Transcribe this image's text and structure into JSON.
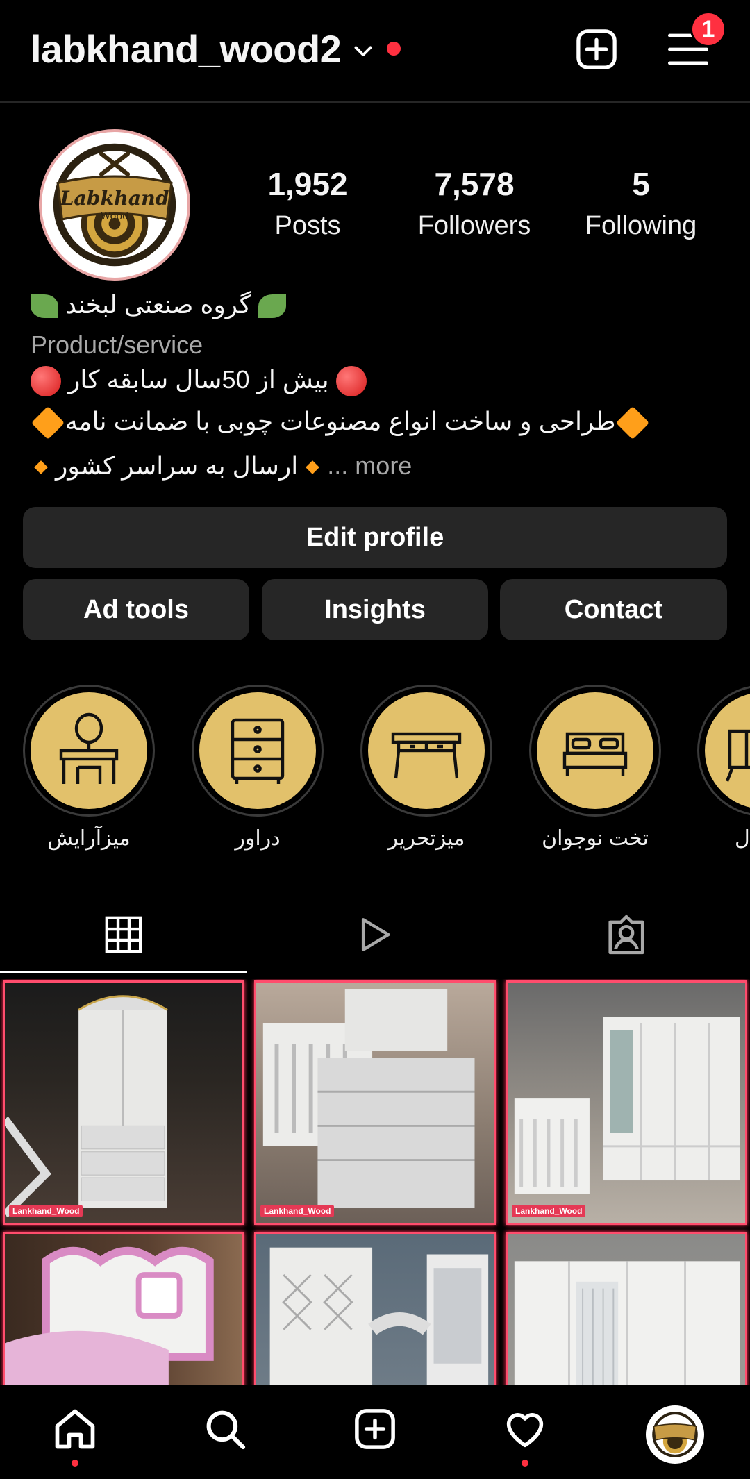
{
  "header": {
    "username": "labkhand_wood2",
    "notification_count": "1"
  },
  "profile": {
    "logo_text_top": "Labkhand",
    "logo_text_bottom": "Wood",
    "stats": [
      {
        "value": "1,952",
        "label": "Posts"
      },
      {
        "value": "7,578",
        "label": "Followers"
      },
      {
        "value": "5",
        "label": "Following"
      }
    ],
    "bio": {
      "name": "گروه صنعتی لبخند",
      "category": "Product/service",
      "line1": "بیش از 50سال سابقه کار",
      "line2": "طراحی و ساخت انواع مصنوعات چوبی با ضمانت نامه",
      "line3": "ارسال به سراسر کشور",
      "more": "... more"
    }
  },
  "buttons": {
    "edit_profile": "Edit profile",
    "ad_tools": "Ad tools",
    "insights": "Insights",
    "contact": "Contact"
  },
  "highlights": [
    {
      "label": "میزآرایش",
      "icon": "vanity-table-icon"
    },
    {
      "label": "دراور",
      "icon": "dresser-icon"
    },
    {
      "label": "میزتحریر",
      "icon": "desk-icon"
    },
    {
      "label": "تخت نوجوان",
      "icon": "bed-icon"
    },
    {
      "label": "ل",
      "icon": "cabinet-icon"
    }
  ],
  "tabs": [
    "grid-icon",
    "reels-icon",
    "tagged-icon"
  ],
  "posts": [
    {
      "watermark": "Lankhand_Wood"
    },
    {
      "watermark": "Lankhand_Wood"
    },
    {
      "watermark": "Lankhand_Wood"
    },
    {
      "watermark": ""
    },
    {
      "watermark": ""
    },
    {
      "watermark": ""
    }
  ],
  "colors": {
    "background": "#000000",
    "button": "#262626",
    "accent_red": "#ff3040",
    "highlight_gold": "#e2c16b",
    "muted_text": "#a8a8a8"
  }
}
